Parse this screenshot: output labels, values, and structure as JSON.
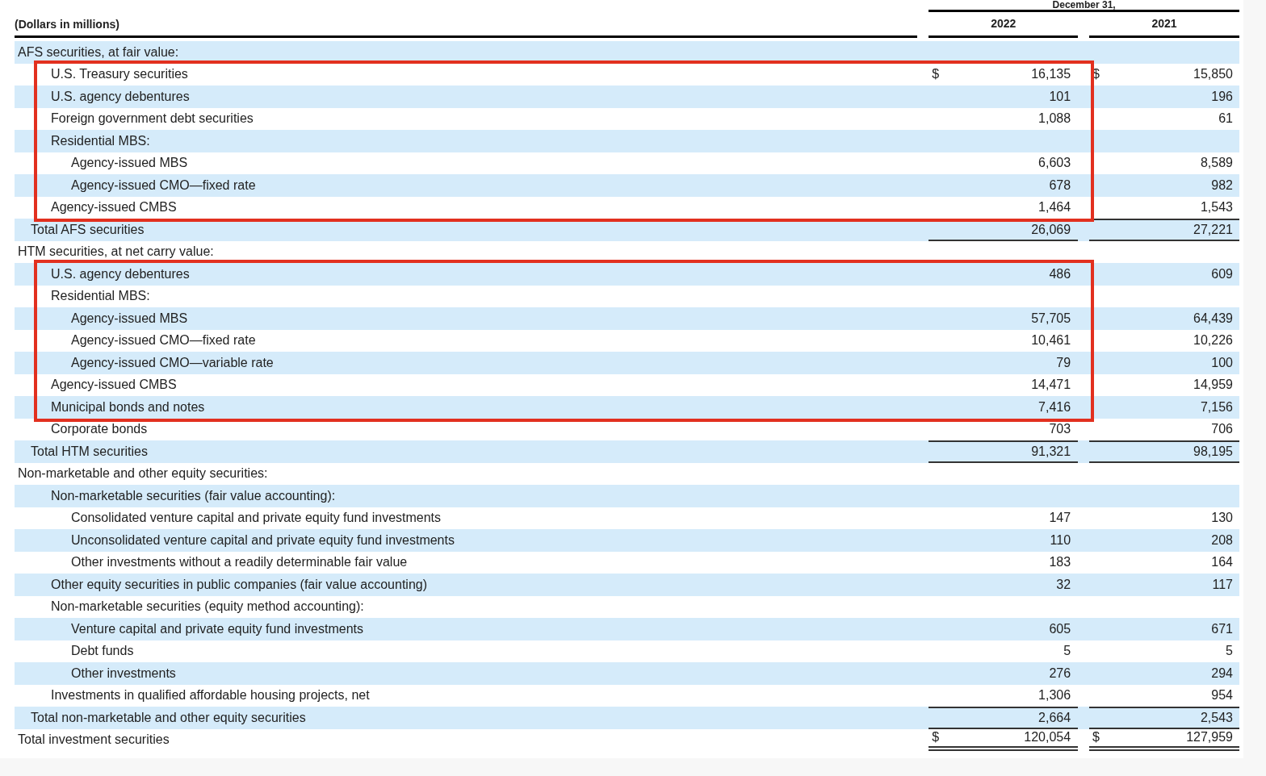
{
  "header": {
    "units": "(Dollars in millions)",
    "period": "December 31,",
    "columns": [
      "2022",
      "2021"
    ]
  },
  "rows": [
    {
      "kind": "section",
      "label": "AFS securities, at fair value:",
      "children": [
        {
          "kind": "highlight",
          "children": [
            {
              "kind": "item",
              "label": "U.S. Treasury securities",
              "values": [
                {
                  "currency": "$",
                  "amount": "16,135"
                },
                {
                  "currency": "$",
                  "amount": "15,850"
                }
              ]
            },
            {
              "kind": "item",
              "label": "U.S. agency debentures",
              "values": [
                {
                  "amount": "101"
                },
                {
                  "amount": "196"
                }
              ]
            },
            {
              "kind": "item",
              "label": "Foreign government debt securities",
              "values": [
                {
                  "amount": "1,088"
                },
                {
                  "amount": "61"
                }
              ]
            },
            {
              "kind": "section",
              "label": "Residential MBS:",
              "children": [
                {
                  "kind": "item",
                  "label": "Agency-issued MBS",
                  "values": [
                    {
                      "amount": "6,603"
                    },
                    {
                      "amount": "8,589"
                    }
                  ]
                },
                {
                  "kind": "item",
                  "label": "Agency-issued CMO—fixed rate",
                  "values": [
                    {
                      "amount": "678"
                    },
                    {
                      "amount": "982"
                    }
                  ]
                }
              ]
            },
            {
              "kind": "item",
              "label": "Agency-issued CMBS",
              "values": [
                {
                  "amount": "1,464"
                },
                {
                  "amount": "1,543"
                }
              ]
            }
          ]
        }
      ]
    },
    {
      "kind": "total",
      "label": "Total AFS securities",
      "values": [
        {
          "amount": "26,069"
        },
        {
          "amount": "27,221"
        }
      ]
    },
    {
      "kind": "section",
      "label": "HTM securities, at net carry value:",
      "children": [
        {
          "kind": "highlight",
          "children": [
            {
              "kind": "item",
              "label": "U.S. agency debentures",
              "values": [
                {
                  "amount": "486"
                },
                {
                  "amount": "609"
                }
              ]
            },
            {
              "kind": "section",
              "label": "Residential MBS:",
              "children": [
                {
                  "kind": "item",
                  "label": "Agency-issued MBS",
                  "values": [
                    {
                      "amount": "57,705"
                    },
                    {
                      "amount": "64,439"
                    }
                  ]
                },
                {
                  "kind": "item",
                  "label": "Agency-issued CMO—fixed rate",
                  "values": [
                    {
                      "amount": "10,461"
                    },
                    {
                      "amount": "10,226"
                    }
                  ]
                },
                {
                  "kind": "item",
                  "label": "Agency-issued CMO—variable rate",
                  "values": [
                    {
                      "amount": "79"
                    },
                    {
                      "amount": "100"
                    }
                  ]
                }
              ]
            },
            {
              "kind": "item",
              "label": "Agency-issued CMBS",
              "values": [
                {
                  "amount": "14,471"
                },
                {
                  "amount": "14,959"
                }
              ]
            },
            {
              "kind": "item",
              "label": "Municipal bonds and notes",
              "values": [
                {
                  "amount": "7,416"
                },
                {
                  "amount": "7,156"
                }
              ]
            }
          ]
        },
        {
          "kind": "item",
          "label": "Corporate bonds",
          "values": [
            {
              "amount": "703"
            },
            {
              "amount": "706"
            }
          ]
        }
      ]
    },
    {
      "kind": "total",
      "label": "Total HTM securities",
      "values": [
        {
          "amount": "91,321"
        },
        {
          "amount": "98,195"
        }
      ]
    },
    {
      "kind": "section",
      "label": "Non-marketable and other equity securities:",
      "children": [
        {
          "kind": "section",
          "label": "Non-marketable securities (fair value accounting):",
          "children": [
            {
              "kind": "item",
              "label": "Consolidated venture capital and private equity fund investments",
              "values": [
                {
                  "amount": "147"
                },
                {
                  "amount": "130"
                }
              ]
            },
            {
              "kind": "item",
              "label": "Unconsolidated venture capital and private equity fund investments",
              "values": [
                {
                  "amount": "110"
                },
                {
                  "amount": "208"
                }
              ]
            },
            {
              "kind": "item",
              "label": "Other investments without a readily determinable fair value",
              "values": [
                {
                  "amount": "183"
                },
                {
                  "amount": "164"
                }
              ]
            }
          ]
        },
        {
          "kind": "item",
          "label": "Other equity securities in public companies (fair value accounting)",
          "values": [
            {
              "amount": "32"
            },
            {
              "amount": "117"
            }
          ]
        },
        {
          "kind": "section",
          "label": "Non-marketable securities (equity method accounting):",
          "children": [
            {
              "kind": "item",
              "label": "Venture capital and private equity fund investments",
              "values": [
                {
                  "amount": "605"
                },
                {
                  "amount": "671"
                }
              ]
            },
            {
              "kind": "item",
              "label": "Debt funds",
              "values": [
                {
                  "amount": "5"
                },
                {
                  "amount": "5"
                }
              ]
            },
            {
              "kind": "item",
              "label": "Other investments",
              "values": [
                {
                  "amount": "276"
                },
                {
                  "amount": "294"
                }
              ]
            }
          ]
        },
        {
          "kind": "item",
          "label": "Investments in qualified affordable housing projects, net",
          "values": [
            {
              "amount": "1,306"
            },
            {
              "amount": "954"
            }
          ]
        }
      ]
    },
    {
      "kind": "total",
      "label": "Total non-marketable and other equity securities",
      "values": [
        {
          "amount": "2,664"
        },
        {
          "amount": "2,543"
        }
      ]
    },
    {
      "kind": "grand_total",
      "label": "Total investment securities",
      "values": [
        {
          "currency": "$",
          "amount": "120,054"
        },
        {
          "currency": "$",
          "amount": "127,959"
        }
      ]
    }
  ]
}
